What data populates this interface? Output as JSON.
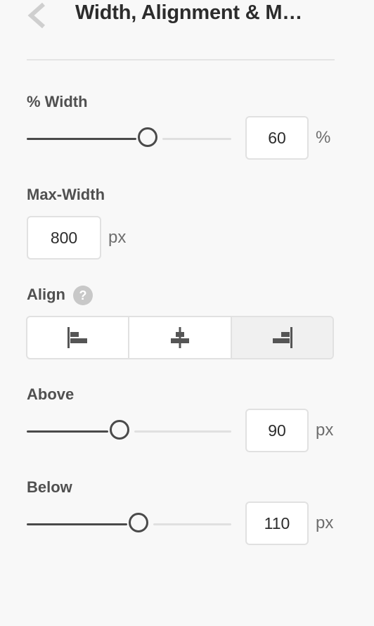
{
  "header": {
    "title": "Width, Alignment & M…",
    "back_icon": "chevron-left-icon"
  },
  "width": {
    "label": "% Width",
    "value": "60",
    "unit": "%",
    "fraction": 0.6
  },
  "max_width": {
    "label": "Max-Width",
    "value": "800",
    "unit": "px"
  },
  "align": {
    "label": "Align",
    "help_glyph": "?",
    "options": [
      "align-left",
      "align-center",
      "align-right"
    ],
    "selected": "align-right"
  },
  "above": {
    "label": "Above",
    "value": "90",
    "unit": "px",
    "fraction": 0.45
  },
  "below": {
    "label": "Below",
    "value": "110",
    "unit": "px",
    "fraction": 0.55
  },
  "colors": {
    "accent": "#4a4a4a",
    "track": "#e0e0e0",
    "border": "#e1e1e1",
    "background": "#f8f8f8"
  }
}
